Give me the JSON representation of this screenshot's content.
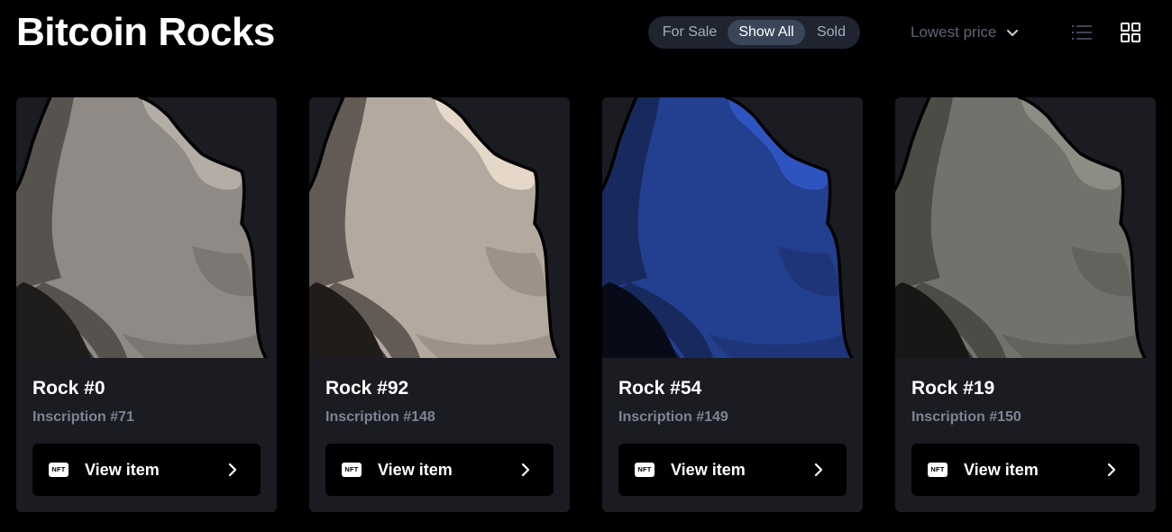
{
  "header": {
    "title": "Bitcoin Rocks",
    "filters": [
      "For Sale",
      "Show All",
      "Sold"
    ],
    "active_filter": "Show All",
    "sort_label": "Lowest price",
    "view_modes": [
      "list-view-icon",
      "grid-view-icon"
    ],
    "active_view": "grid"
  },
  "cards": [
    {
      "name": "Rock #0",
      "inscription": "Inscription #71",
      "button_label": "View item",
      "badge": "NFT",
      "palette": {
        "main": "#8f8a85",
        "light": "#b3ada6",
        "mid": "#7b7772",
        "dark": "#56524e",
        "darker": "#3b3936",
        "shadow": "#1e1d1b"
      }
    },
    {
      "name": "Rock #92",
      "inscription": "Inscription #148",
      "button_label": "View item",
      "badge": "NFT",
      "palette": {
        "main": "#b4a99e",
        "light": "#e6d8c8",
        "mid": "#9d9289",
        "dark": "#625a54",
        "darker": "#403b37",
        "shadow": "#1f1c1a"
      }
    },
    {
      "name": "Rock #54",
      "inscription": "Inscription #149",
      "button_label": "View item",
      "badge": "NFT",
      "palette": {
        "main": "#233f8f",
        "light": "#2e55bf",
        "mid": "#1e3679",
        "dark": "#18295d",
        "darker": "#111d42",
        "shadow": "#070b17"
      }
    },
    {
      "name": "Rock #19",
      "inscription": "Inscription #150",
      "button_label": "View item",
      "badge": "NFT",
      "palette": {
        "main": "#6f736b",
        "light": "#8a8e84",
        "mid": "#61645d",
        "dark": "#4a4c46",
        "darker": "#343632",
        "shadow": "#171816"
      }
    }
  ]
}
